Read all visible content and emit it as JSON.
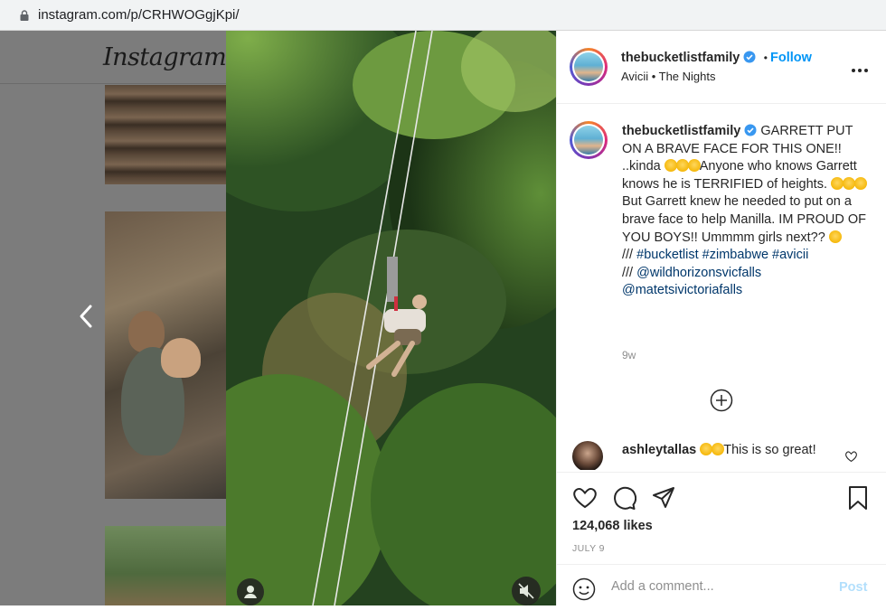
{
  "browser": {
    "url": "instagram.com/p/CRHWOGgjKpi/"
  },
  "background": {
    "logo_text": "Instagram"
  },
  "post": {
    "username": "thebucketlistfamily",
    "follow_label": "Follow",
    "separator": "•",
    "audio": "Avicii • The Nights",
    "caption": {
      "username": "thebucketlistfamily",
      "line1": "GARRETT PUT ON A BRAVE FACE FOR THIS ONE!! ..kinda ",
      "line2": "Anyone who knows Garrett knows he is TERRIFIED of heights. ",
      "line3": "But Garrett knew he needed to put on a brave face to help Manilla. IM PROUD OF YOU BOYS!! Ummmm girls next?? ",
      "hashtags_prefix": "/// ",
      "hashtags": "#bucketlist #zimbabwe #avicii",
      "mention1_prefix": "/// ",
      "mention1": "@wildhorizonsvicfalls",
      "mention2": "@matetsivictoriafalls"
    },
    "time_ago": "9w",
    "likes": "124,068 likes",
    "date": "JULY 9"
  },
  "comments": [
    {
      "username": "ashleytallas",
      "text": "This is so great!"
    }
  ],
  "comment_box": {
    "placeholder": "Add a comment...",
    "post_label": "Post"
  },
  "colors": {
    "link_blue": "#0095f6",
    "post_disabled": "#b2dffc",
    "verified_blue": "#3897f0"
  },
  "icons": [
    "lock-icon",
    "chevron-left-icon",
    "user-tag-icon",
    "mute-icon",
    "verified-icon",
    "more-icon",
    "add-circle-icon",
    "heart-icon",
    "comment-icon",
    "share-icon",
    "bookmark-icon",
    "emoji-icon"
  ]
}
